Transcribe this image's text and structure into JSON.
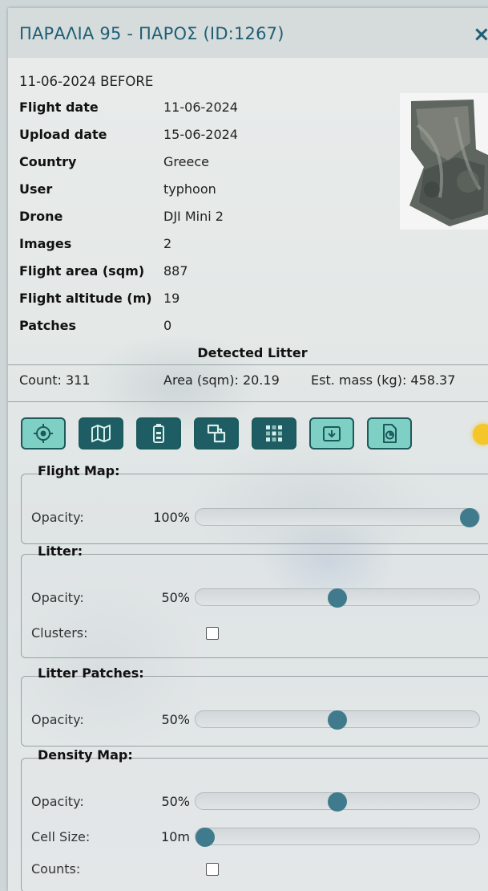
{
  "header": {
    "title": "ΠΑΡΑΛΙΑ 95 - ΠΑΡΟΣ (ID:1267)",
    "close_label": "×"
  },
  "flight_label": "11-06-2024 BEFORE",
  "details": [
    {
      "key": "Flight date",
      "value": "11-06-2024"
    },
    {
      "key": "Upload date",
      "value": "15-06-2024"
    },
    {
      "key": "Country",
      "value": "Greece"
    },
    {
      "key": "User",
      "value": "typhoon"
    },
    {
      "key": "Drone",
      "value": "DJI Mini 2"
    },
    {
      "key": "Images",
      "value": "2"
    },
    {
      "key": "Flight area (sqm)",
      "value": "887"
    },
    {
      "key": "Flight altitude (m)",
      "value": "19"
    },
    {
      "key": "Patches",
      "value": "0"
    }
  ],
  "detected": {
    "title": "Detected Litter",
    "count": "Count: 311",
    "area": "Area (sqm): 20.19",
    "mass": "Est. mass (kg): 458.37"
  },
  "toolbar": {
    "buttons": [
      {
        "icon": "locate-icon",
        "style": "light"
      },
      {
        "icon": "map-icon",
        "style": "dark"
      },
      {
        "icon": "battery-icon",
        "style": "dark"
      },
      {
        "icon": "layers-icon",
        "style": "dark"
      },
      {
        "icon": "grid-icon",
        "style": "dark"
      },
      {
        "icon": "download-folder-icon",
        "style": "light"
      },
      {
        "icon": "file-export-icon",
        "style": "light"
      }
    ],
    "status_color": "#f5c629"
  },
  "sections": {
    "flight_map": {
      "legend": "Flight Map:",
      "opacity_label": "Opacity:",
      "opacity_value": "100%",
      "opacity": 1.0
    },
    "litter": {
      "legend": "Litter:",
      "opacity_label": "Opacity:",
      "opacity_value": "50%",
      "opacity": 0.5,
      "clusters_label": "Clusters:",
      "clusters_checked": false
    },
    "litter_patches": {
      "legend": "Litter Patches:",
      "opacity_label": "Opacity:",
      "opacity_value": "50%",
      "opacity": 0.5
    },
    "density_map": {
      "legend": "Density Map:",
      "opacity_label": "Opacity:",
      "opacity_value": "50%",
      "opacity": 0.5,
      "cell_size_label": "Cell Size:",
      "cell_size_value": "10m",
      "cell_size": 0.0,
      "counts_label": "Counts:",
      "counts_checked": false
    }
  },
  "colors": {
    "accent": "#1f5f75",
    "button_dark": "#1e5d63",
    "button_light": "#7fd0c4",
    "knob": "#3f7b8d"
  }
}
